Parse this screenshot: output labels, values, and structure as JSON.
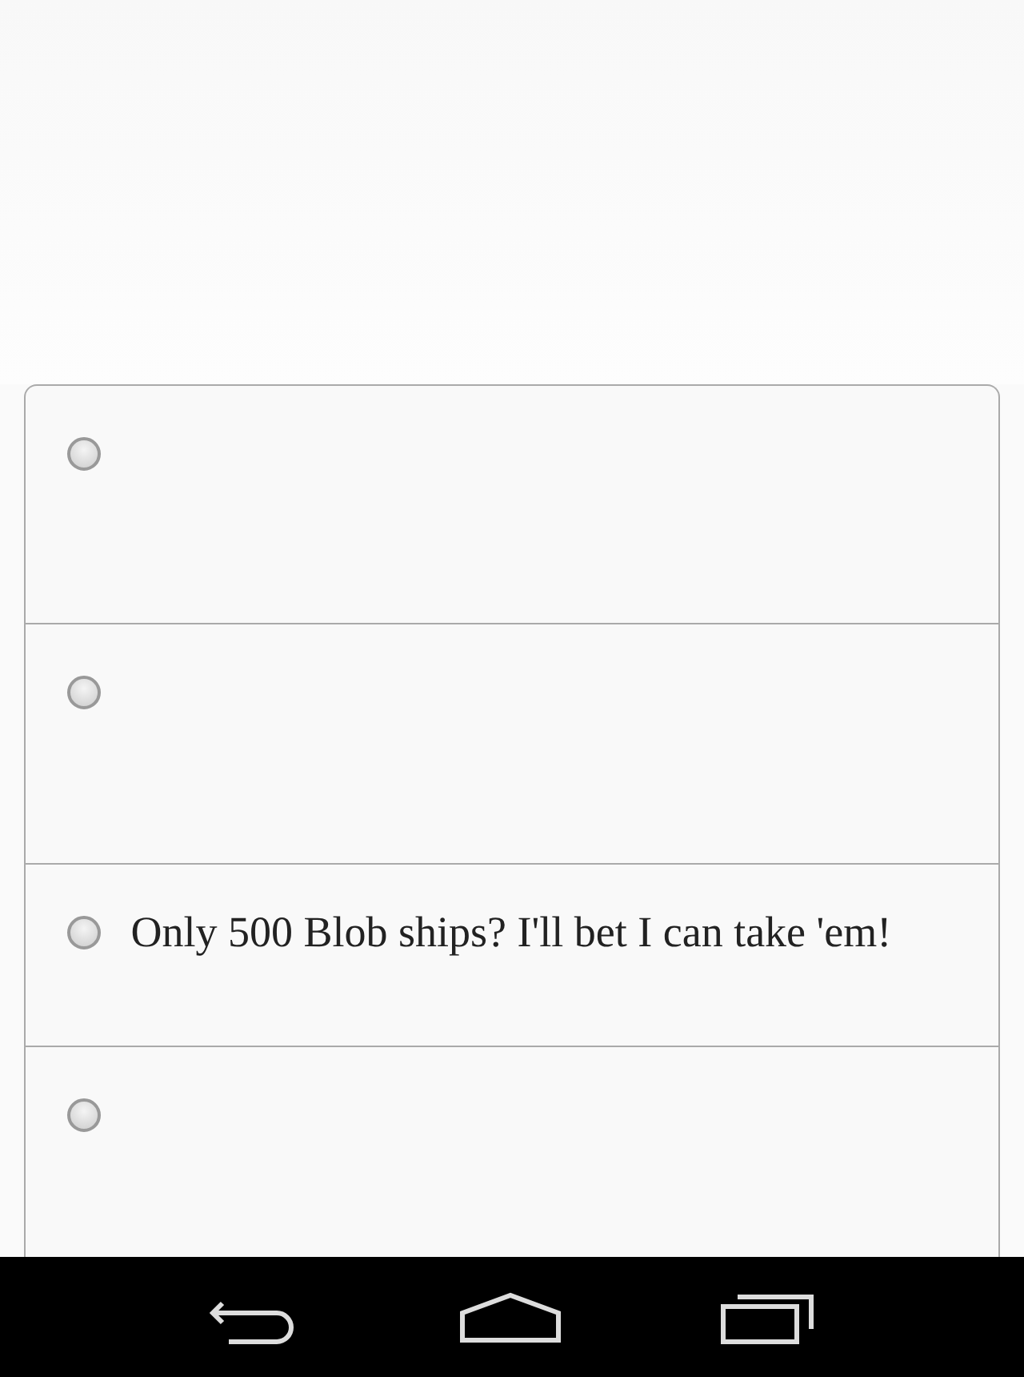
{
  "options": [
    {
      "selected": false
    },
    {
      "selected": false
    },
    {
      "selected": false,
      "label": "Only 500 Blob ships? I'll bet I can take 'em!"
    },
    {
      "selected": false
    }
  ]
}
